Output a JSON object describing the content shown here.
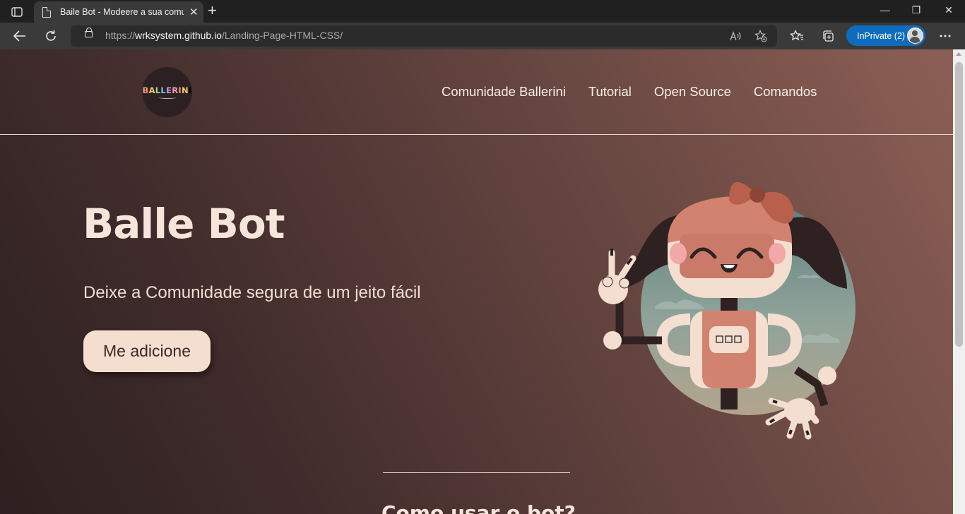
{
  "browser": {
    "tab_title": "Baile Bot - Modeere a sua comunidade",
    "tab_close": "✕",
    "new_tab": "+",
    "window_buttons": {
      "minimize": "—",
      "restore": "❐",
      "close": "✕"
    },
    "url_scheme": "https://",
    "url_host": "wrksystem.github.io",
    "url_path": "/Landing-Page-HTML-CSS/",
    "inprivate_label": "InPrivate (2)",
    "icons": [
      "tab-actions-icon",
      "back-icon",
      "refresh-icon",
      "lock-icon",
      "read-aloud-icon",
      "add-favorite-icon",
      "favorites-icon",
      "collections-icon",
      "profile-avatar-icon",
      "more-icon"
    ],
    "accent": "#0f6cbd"
  },
  "site": {
    "logo_letters": [
      "B",
      "A",
      "L",
      "L",
      "E",
      "R",
      "I",
      "N",
      "I"
    ],
    "nav": [
      {
        "label": "Comunidade Ballerini"
      },
      {
        "label": "Tutorial"
      },
      {
        "label": "Open Source"
      },
      {
        "label": "Comandos"
      }
    ],
    "hero": {
      "title": "Balle Bot",
      "subtitle": "Deixe a Comunidade segura de um jeito fácil",
      "cta_label": "Me adicione"
    },
    "next_section_heading": "Como usar o bot?",
    "colors": {
      "bg_dark": "#2e2020",
      "bg_light": "#8c5f55",
      "cream": "#f3ded0",
      "robot_pink": "#d2836f",
      "robot_hair": "#2f2121"
    }
  }
}
